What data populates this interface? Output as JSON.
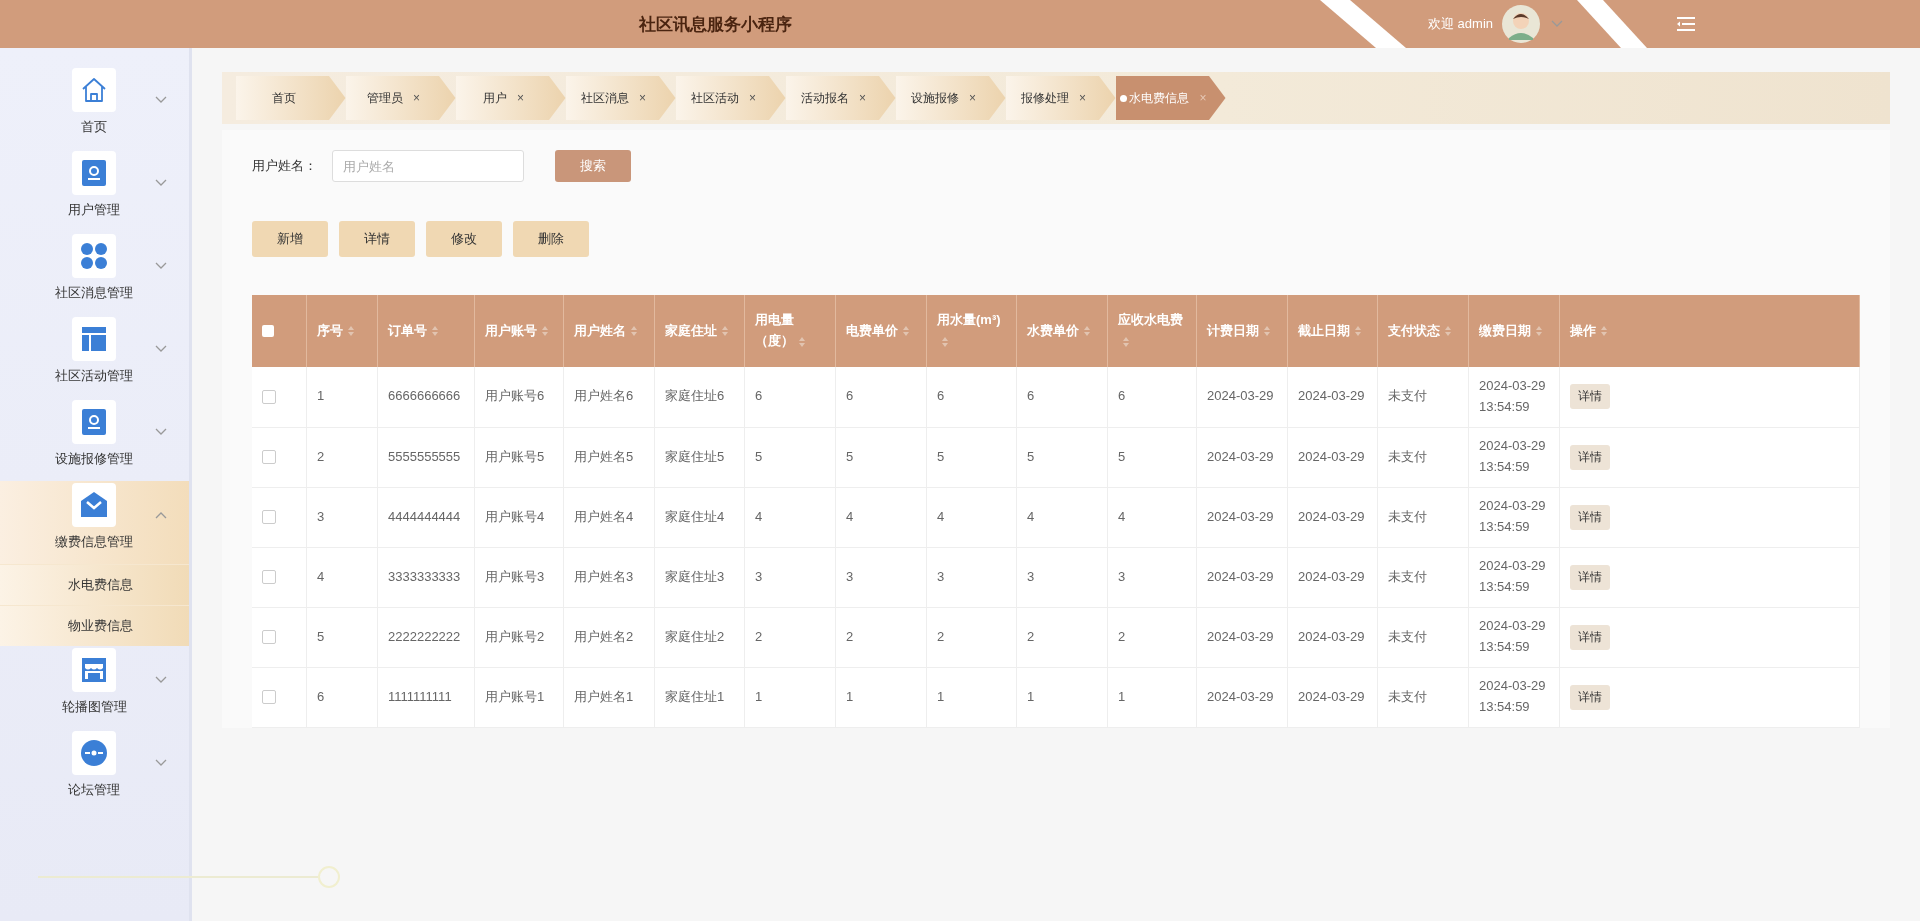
{
  "header": {
    "title": "社区讯息服务小程序",
    "welcome": "欢迎 admin"
  },
  "sidebar": {
    "items": [
      {
        "label": "首页",
        "expanded": false
      },
      {
        "label": "用户管理",
        "expanded": false
      },
      {
        "label": "社区消息管理",
        "expanded": false
      },
      {
        "label": "社区活动管理",
        "expanded": false
      },
      {
        "label": "设施报修管理",
        "expanded": false
      },
      {
        "label": "缴费信息管理",
        "expanded": true,
        "children": [
          {
            "label": "水电费信息"
          },
          {
            "label": "物业费信息"
          }
        ]
      },
      {
        "label": "轮播图管理",
        "expanded": false
      },
      {
        "label": "论坛管理",
        "expanded": false
      }
    ]
  },
  "tabs": [
    {
      "label": "首页",
      "selected": false
    },
    {
      "label": "管理员",
      "close": "×",
      "selected": false
    },
    {
      "label": "用户",
      "close": "×",
      "selected": false
    },
    {
      "label": "社区消息",
      "close": "×",
      "selected": false
    },
    {
      "label": "社区活动",
      "close": "×",
      "selected": false
    },
    {
      "label": "活动报名",
      "close": "×",
      "selected": false
    },
    {
      "label": "设施报修",
      "close": "×",
      "selected": false
    },
    {
      "label": "报修处理",
      "close": "×",
      "selected": false
    },
    {
      "label": "水电费信息",
      "close": "×",
      "selected": true
    }
  ],
  "search": {
    "label": "用户姓名：",
    "placeholder": "用户姓名",
    "button": "搜索"
  },
  "actions": [
    "新增",
    "详情",
    "修改",
    "删除"
  ],
  "table": {
    "select_all_checked": false,
    "columns": [
      {
        "label": "序号",
        "sortable": true
      },
      {
        "label": "订单号",
        "sortable": true
      },
      {
        "label": "用户账号",
        "sortable": true
      },
      {
        "label": "用户姓名",
        "sortable": true
      },
      {
        "label": "家庭住址",
        "sortable": true
      },
      {
        "label": "用电量（度）",
        "sortable": true
      },
      {
        "label": "电费单价",
        "sortable": true
      },
      {
        "label": "用水量(m³)",
        "sortable": true
      },
      {
        "label": "水费单价",
        "sortable": true
      },
      {
        "label": "应收水电费",
        "sortable": true
      },
      {
        "label": "计费日期",
        "sortable": true
      },
      {
        "label": "截止日期",
        "sortable": true
      },
      {
        "label": "支付状态",
        "sortable": true
      },
      {
        "label": "缴费日期",
        "sortable": true
      },
      {
        "label": "操作",
        "sortable": true
      }
    ],
    "rows": [
      {
        "checked": false,
        "cells": [
          "1",
          "6666666666",
          "用户账号6",
          "用户姓名6",
          "家庭住址6",
          "6",
          "6",
          "6",
          "6",
          "6",
          "2024-03-29",
          "2024-03-29",
          "未支付",
          "2024-03-29 13:54:59"
        ],
        "action": "详情"
      },
      {
        "checked": false,
        "cells": [
          "2",
          "5555555555",
          "用户账号5",
          "用户姓名5",
          "家庭住址5",
          "5",
          "5",
          "5",
          "5",
          "5",
          "2024-03-29",
          "2024-03-29",
          "未支付",
          "2024-03-29 13:54:59"
        ],
        "action": "详情"
      },
      {
        "checked": false,
        "cells": [
          "3",
          "4444444444",
          "用户账号4",
          "用户姓名4",
          "家庭住址4",
          "4",
          "4",
          "4",
          "4",
          "4",
          "2024-03-29",
          "2024-03-29",
          "未支付",
          "2024-03-29 13:54:59"
        ],
        "action": "详情"
      },
      {
        "checked": false,
        "cells": [
          "4",
          "3333333333",
          "用户账号3",
          "用户姓名3",
          "家庭住址3",
          "3",
          "3",
          "3",
          "3",
          "3",
          "2024-03-29",
          "2024-03-29",
          "未支付",
          "2024-03-29 13:54:59"
        ],
        "action": "详情"
      },
      {
        "checked": false,
        "cells": [
          "5",
          "2222222222",
          "用户账号2",
          "用户姓名2",
          "家庭住址2",
          "2",
          "2",
          "2",
          "2",
          "2",
          "2024-03-29",
          "2024-03-29",
          "未支付",
          "2024-03-29 13:54:59"
        ],
        "action": "详情"
      },
      {
        "checked": false,
        "cells": [
          "6",
          "1111111111",
          "用户账号1",
          "用户姓名1",
          "家庭住址1",
          "1",
          "1",
          "1",
          "1",
          "1",
          "2024-03-29",
          "2024-03-29",
          "未支付",
          "2024-03-29 13:54:59"
        ],
        "action": "详情"
      }
    ]
  }
}
